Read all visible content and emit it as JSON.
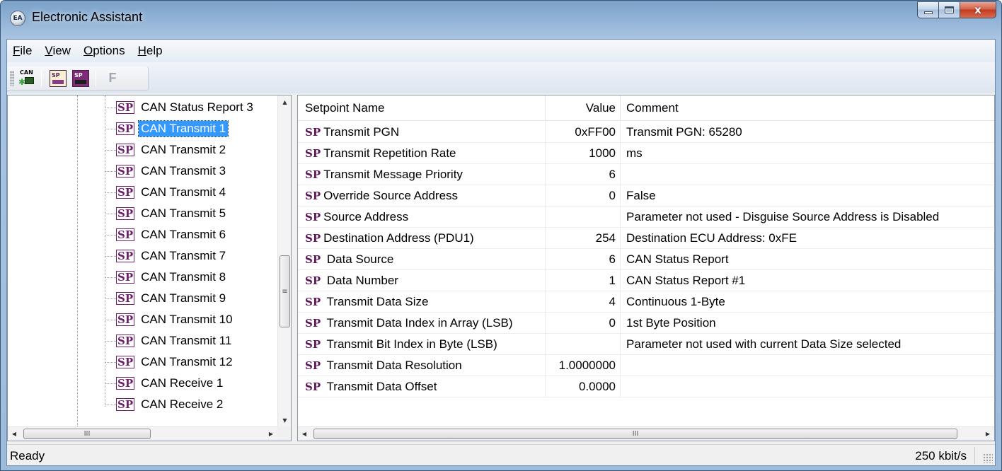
{
  "window": {
    "title": "Electronic Assistant",
    "icon": "EA",
    "close_glyph": "x"
  },
  "menu": [
    {
      "label": "File",
      "u": "F",
      "rest": "ile"
    },
    {
      "label": "View",
      "u": "V",
      "rest": "iew"
    },
    {
      "label": "Options",
      "u": "O",
      "rest": "ptions"
    },
    {
      "label": "Help",
      "u": "H",
      "rest": "elp"
    }
  ],
  "toolbar": {
    "connect_icon_text": "CAN",
    "open_icon_text": "SP",
    "save_icon_text": "SP",
    "f_label": "F"
  },
  "tree": {
    "badge": "SP",
    "selected_index": 1,
    "items": [
      "CAN Status Report 3",
      "CAN Transmit 1",
      "CAN Transmit 2",
      "CAN Transmit 3",
      "CAN Transmit 4",
      "CAN Transmit 5",
      "CAN Transmit 6",
      "CAN Transmit 7",
      "CAN Transmit 8",
      "CAN Transmit 9",
      "CAN Transmit 10",
      "CAN Transmit 11",
      "CAN Transmit 12",
      "CAN Receive 1",
      "CAN Receive 2"
    ]
  },
  "scrollbar": {
    "up": "▲",
    "down": "▼",
    "left": "◀",
    "right": "▶",
    "v_grip": "≡",
    "h_grip": "III"
  },
  "table": {
    "columns": [
      "Setpoint Name",
      "Value",
      "Comment"
    ],
    "rows": [
      {
        "tag": "SP",
        "name": "Transmit PGN",
        "value": "0xFF00",
        "comment": "Transmit PGN: 65280"
      },
      {
        "tag": "SP",
        "name": "Transmit Repetition Rate",
        "value": "1000",
        "comment": "ms"
      },
      {
        "tag": "SP",
        "name": "Transmit Message Priority",
        "value": "6",
        "comment": ""
      },
      {
        "tag": "SP",
        "name": "Override Source Address",
        "value": "0",
        "comment": "False"
      },
      {
        "tag": "SP",
        "name": "Source Address",
        "value": "",
        "comment": "Parameter not used - Disguise Source Address is Disabled"
      },
      {
        "tag": "SP",
        "name": "Destination Address (PDU1)",
        "value": "254",
        "comment": "Destination ECU Address: 0xFE"
      },
      {
        "tag": "SP",
        "name": " Data Source",
        "value": "6",
        "comment": "CAN Status Report"
      },
      {
        "tag": "SP",
        "name": " Data Number",
        "value": "1",
        "comment": "CAN Status Report #1"
      },
      {
        "tag": "SP",
        "name": " Transmit Data Size",
        "value": "4",
        "comment": "Continuous 1-Byte"
      },
      {
        "tag": "SP",
        "name": " Transmit Data Index in Array (LSB)",
        "value": "0",
        "comment": "1st Byte Position"
      },
      {
        "tag": "SP",
        "name": " Transmit Bit Index in Byte (LSB)",
        "value": "",
        "comment": "Parameter not used with current Data Size selected"
      },
      {
        "tag": "SP",
        "name": " Transmit Data Resolution",
        "value": "1.0000000",
        "comment": ""
      },
      {
        "tag": "SP",
        "name": " Transmit Data Offset",
        "value": "0.0000",
        "comment": ""
      }
    ]
  },
  "status": {
    "left": "Ready",
    "right": "250 kbit/s"
  }
}
